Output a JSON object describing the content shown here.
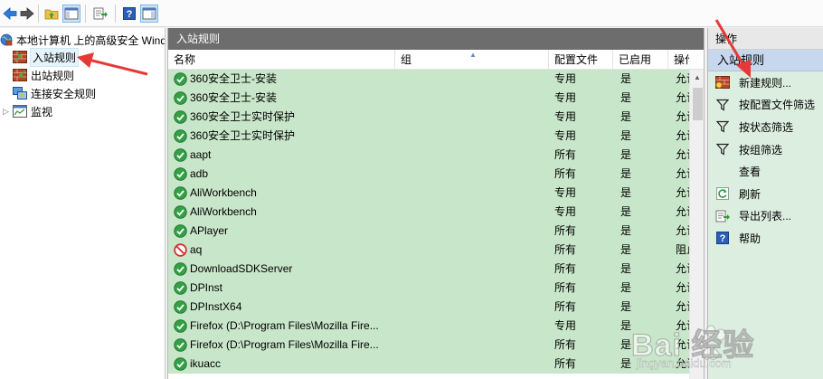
{
  "colors": {
    "row_bg": "#c8e6c9",
    "panel_title_bg": "#6d6d6d",
    "actions_header_bg": "#c6d7ee",
    "arrow": "#e53935"
  },
  "toolbar": {
    "icons": [
      "back-arrow-icon",
      "forward-arrow-icon",
      "up-folder-icon",
      "show-hide-tree-icon",
      "export-list-icon",
      "help-icon",
      "show-hide-action-pane-icon"
    ]
  },
  "tree": {
    "root": "本地计算机 上的高级安全 Windows",
    "items": [
      {
        "label": "入站规则",
        "selected": true
      },
      {
        "label": "出站规则",
        "selected": false
      },
      {
        "label": "连接安全规则",
        "selected": false
      },
      {
        "label": "监视",
        "selected": false
      }
    ]
  },
  "center": {
    "title": "入站规则",
    "columns": [
      "名称",
      "组",
      "配置文件",
      "已启用",
      "操作"
    ],
    "rows": [
      {
        "status": "allow",
        "name": "360安全卫士-安装",
        "group": "",
        "profile": "专用",
        "enabled": "是",
        "action": "允许"
      },
      {
        "status": "allow",
        "name": "360安全卫士-安装",
        "group": "",
        "profile": "专用",
        "enabled": "是",
        "action": "允许"
      },
      {
        "status": "allow",
        "name": "360安全卫士实时保护",
        "group": "",
        "profile": "专用",
        "enabled": "是",
        "action": "允许"
      },
      {
        "status": "allow",
        "name": "360安全卫士实时保护",
        "group": "",
        "profile": "专用",
        "enabled": "是",
        "action": "允许"
      },
      {
        "status": "allow",
        "name": "aapt",
        "group": "",
        "profile": "所有",
        "enabled": "是",
        "action": "允许"
      },
      {
        "status": "allow",
        "name": "adb",
        "group": "",
        "profile": "所有",
        "enabled": "是",
        "action": "允许"
      },
      {
        "status": "allow",
        "name": "AliWorkbench",
        "group": "",
        "profile": "专用",
        "enabled": "是",
        "action": "允许"
      },
      {
        "status": "allow",
        "name": "AliWorkbench",
        "group": "",
        "profile": "专用",
        "enabled": "是",
        "action": "允许"
      },
      {
        "status": "allow",
        "name": "APlayer",
        "group": "",
        "profile": "所有",
        "enabled": "是",
        "action": "允许"
      },
      {
        "status": "block",
        "name": "aq",
        "group": "",
        "profile": "所有",
        "enabled": "是",
        "action": "阻止"
      },
      {
        "status": "allow",
        "name": "DownloadSDKServer",
        "group": "",
        "profile": "所有",
        "enabled": "是",
        "action": "允许"
      },
      {
        "status": "allow",
        "name": "DPInst",
        "group": "",
        "profile": "所有",
        "enabled": "是",
        "action": "允许"
      },
      {
        "status": "allow",
        "name": "DPInstX64",
        "group": "",
        "profile": "所有",
        "enabled": "是",
        "action": "允许"
      },
      {
        "status": "allow",
        "name": "Firefox (D:\\Program Files\\Mozilla Fire...",
        "group": "",
        "profile": "专用",
        "enabled": "是",
        "action": "允许"
      },
      {
        "status": "allow",
        "name": "Firefox (D:\\Program Files\\Mozilla Fire...",
        "group": "",
        "profile": "所有",
        "enabled": "是",
        "action": "允许"
      },
      {
        "status": "allow",
        "name": "ikuacc",
        "group": "",
        "profile": "所有",
        "enabled": "是",
        "action": "允许"
      }
    ]
  },
  "actions": {
    "title": "操作",
    "section": "入站规则",
    "items": [
      {
        "icon": "new-rule-icon",
        "label": "新建规则..."
      },
      {
        "icon": "filter-icon",
        "label": "按配置文件筛选"
      },
      {
        "icon": "filter-icon",
        "label": "按状态筛选"
      },
      {
        "icon": "filter-icon",
        "label": "按组筛选"
      },
      {
        "icon": "",
        "label": "查看"
      },
      {
        "icon": "refresh-icon",
        "label": "刷新"
      },
      {
        "icon": "export-list-icon",
        "label": "导出列表..."
      },
      {
        "icon": "help-icon",
        "label": "帮助"
      }
    ]
  },
  "watermark": {
    "text": "Bai 经验",
    "sub": "jingyan.baidu.com"
  }
}
